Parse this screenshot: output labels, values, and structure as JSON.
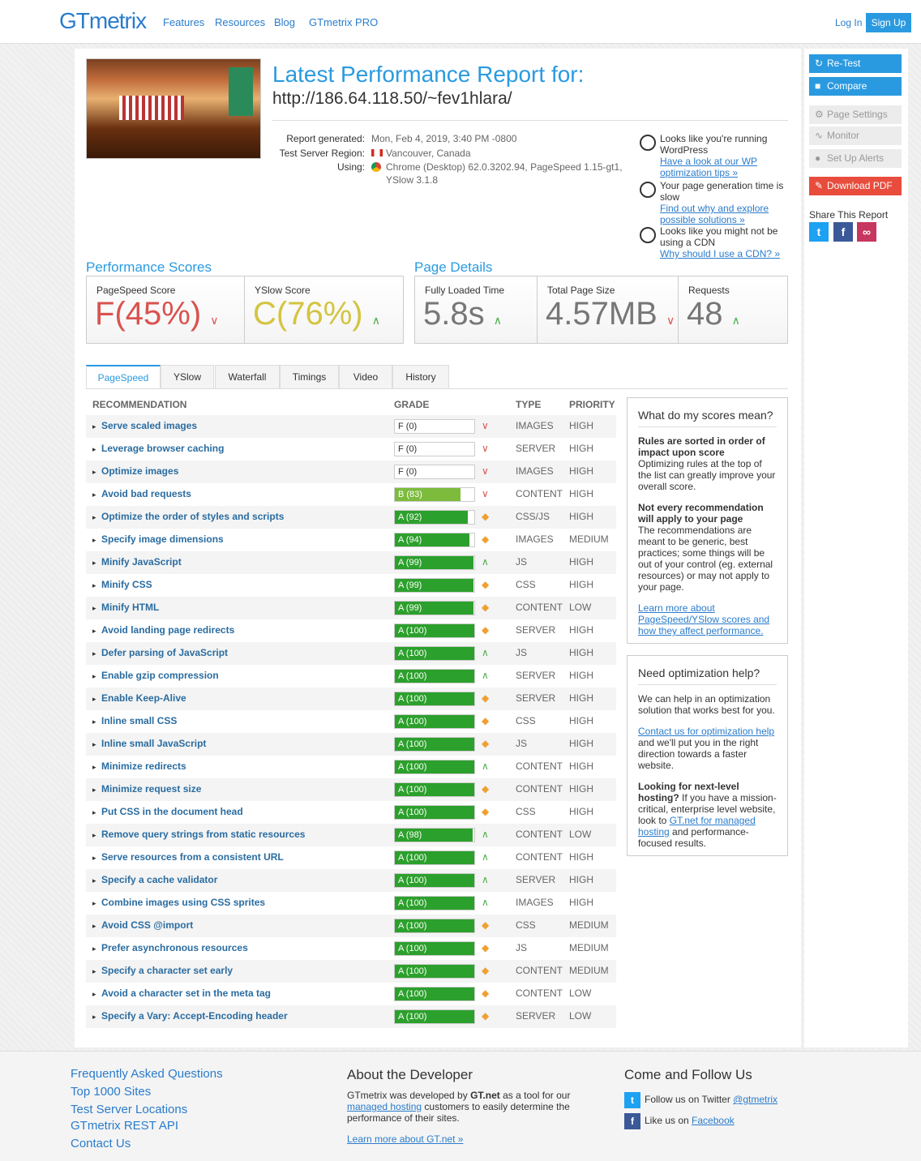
{
  "header": {
    "logo": "GTmetrix",
    "nav": [
      "Features",
      "Resources",
      "Blog",
      "GTmetrix PRO"
    ],
    "login": "Log In",
    "signup": "Sign Up"
  },
  "report": {
    "title": "Latest Performance Report for:",
    "url": "http://186.64.118.50/~fev1hlara/",
    "generated_label": "Report generated:",
    "generated_value": "Mon, Feb 4, 2019, 3:40 PM -0800",
    "region_label": "Test Server Region:",
    "region_value": "Vancouver, Canada",
    "using_label": "Using:",
    "using_value_1": "Chrome (Desktop) 62.0.3202.94, PageSpeed 1.15-gt1,",
    "using_value_2": "YSlow 3.1.8"
  },
  "tips": [
    {
      "text": "Looks like you're running WordPress",
      "link": "Have a look at our WP optimization tips »"
    },
    {
      "text": "Your page generation time is slow",
      "link": "Find out why and explore possible solutions »"
    },
    {
      "text": "Looks like you might not be using a CDN",
      "link": "Why should I use a CDN? »"
    }
  ],
  "scores": {
    "heading": "Performance Scores",
    "pagespeed_label": "PageSpeed Score",
    "pagespeed_grade": "F",
    "pagespeed_pct": "(45%)",
    "yslow_label": "YSlow Score",
    "yslow_grade": "C",
    "yslow_pct": "(76%)"
  },
  "details": {
    "heading": "Page Details",
    "loaded_label": "Fully Loaded Time",
    "loaded_value": "5.8s",
    "size_label": "Total Page Size",
    "size_value": "4.57MB",
    "requests_label": "Requests",
    "requests_value": "48"
  },
  "tabs": [
    "PageSpeed",
    "YSlow",
    "Waterfall",
    "Timings",
    "Video",
    "History"
  ],
  "table_headers": {
    "recommendation": "RECOMMENDATION",
    "grade": "GRADE",
    "type": "TYPE",
    "priority": "PRIORITY"
  },
  "rows": [
    {
      "name": "Serve scaled images",
      "grade": "F (0)",
      "score": 0,
      "trend": "down",
      "type": "IMAGES",
      "priority": "HIGH"
    },
    {
      "name": "Leverage browser caching",
      "grade": "F (0)",
      "score": 0,
      "trend": "down",
      "type": "SERVER",
      "priority": "HIGH"
    },
    {
      "name": "Optimize images",
      "grade": "F (0)",
      "score": 0,
      "trend": "down",
      "type": "IMAGES",
      "priority": "HIGH"
    },
    {
      "name": "Avoid bad requests",
      "grade": "B (83)",
      "score": 83,
      "trend": "down",
      "type": "CONTENT",
      "priority": "HIGH"
    },
    {
      "name": "Optimize the order of styles and scripts",
      "grade": "A (92)",
      "score": 92,
      "trend": "same",
      "type": "CSS/JS",
      "priority": "HIGH"
    },
    {
      "name": "Specify image dimensions",
      "grade": "A (94)",
      "score": 94,
      "trend": "same",
      "type": "IMAGES",
      "priority": "MEDIUM"
    },
    {
      "name": "Minify JavaScript",
      "grade": "A (99)",
      "score": 99,
      "trend": "up",
      "type": "JS",
      "priority": "HIGH"
    },
    {
      "name": "Minify CSS",
      "grade": "A (99)",
      "score": 99,
      "trend": "same",
      "type": "CSS",
      "priority": "HIGH"
    },
    {
      "name": "Minify HTML",
      "grade": "A (99)",
      "score": 99,
      "trend": "same",
      "type": "CONTENT",
      "priority": "LOW"
    },
    {
      "name": "Avoid landing page redirects",
      "grade": "A (100)",
      "score": 100,
      "trend": "same",
      "type": "SERVER",
      "priority": "HIGH"
    },
    {
      "name": "Defer parsing of JavaScript",
      "grade": "A (100)",
      "score": 100,
      "trend": "up",
      "type": "JS",
      "priority": "HIGH"
    },
    {
      "name": "Enable gzip compression",
      "grade": "A (100)",
      "score": 100,
      "trend": "up",
      "type": "SERVER",
      "priority": "HIGH"
    },
    {
      "name": "Enable Keep-Alive",
      "grade": "A (100)",
      "score": 100,
      "trend": "same",
      "type": "SERVER",
      "priority": "HIGH"
    },
    {
      "name": "Inline small CSS",
      "grade": "A (100)",
      "score": 100,
      "trend": "same",
      "type": "CSS",
      "priority": "HIGH"
    },
    {
      "name": "Inline small JavaScript",
      "grade": "A (100)",
      "score": 100,
      "trend": "same",
      "type": "JS",
      "priority": "HIGH"
    },
    {
      "name": "Minimize redirects",
      "grade": "A (100)",
      "score": 100,
      "trend": "up",
      "type": "CONTENT",
      "priority": "HIGH"
    },
    {
      "name": "Minimize request size",
      "grade": "A (100)",
      "score": 100,
      "trend": "same",
      "type": "CONTENT",
      "priority": "HIGH"
    },
    {
      "name": "Put CSS in the document head",
      "grade": "A (100)",
      "score": 100,
      "trend": "same",
      "type": "CSS",
      "priority": "HIGH"
    },
    {
      "name": "Remove query strings from static resources",
      "grade": "A (98)",
      "score": 98,
      "trend": "up",
      "type": "CONTENT",
      "priority": "LOW"
    },
    {
      "name": "Serve resources from a consistent URL",
      "grade": "A (100)",
      "score": 100,
      "trend": "up",
      "type": "CONTENT",
      "priority": "HIGH"
    },
    {
      "name": "Specify a cache validator",
      "grade": "A (100)",
      "score": 100,
      "trend": "up",
      "type": "SERVER",
      "priority": "HIGH"
    },
    {
      "name": "Combine images using CSS sprites",
      "grade": "A (100)",
      "score": 100,
      "trend": "up",
      "type": "IMAGES",
      "priority": "HIGH"
    },
    {
      "name": "Avoid CSS @import",
      "grade": "A (100)",
      "score": 100,
      "trend": "same",
      "type": "CSS",
      "priority": "MEDIUM"
    },
    {
      "name": "Prefer asynchronous resources",
      "grade": "A (100)",
      "score": 100,
      "trend": "same",
      "type": "JS",
      "priority": "MEDIUM"
    },
    {
      "name": "Specify a character set early",
      "grade": "A (100)",
      "score": 100,
      "trend": "same",
      "type": "CONTENT",
      "priority": "MEDIUM"
    },
    {
      "name": "Avoid a character set in the meta tag",
      "grade": "A (100)",
      "score": 100,
      "trend": "same",
      "type": "CONTENT",
      "priority": "LOW"
    },
    {
      "name": "Specify a Vary: Accept-Encoding header",
      "grade": "A (100)",
      "score": 100,
      "trend": "same",
      "type": "SERVER",
      "priority": "LOW"
    }
  ],
  "scores_box": {
    "title": "What do my scores mean?",
    "p1_bold": "Rules are sorted in order of impact upon score",
    "p1_text": "Optimizing rules at the top of the list can greatly improve your overall score.",
    "p2_bold": "Not every recommendation will apply to your page",
    "p2_text": "The recommendations are meant to be generic, best practices; some things will be out of your control (eg. external resources) or may not apply to your page.",
    "link": "Learn more about PageSpeed/YSlow scores and how they affect performance."
  },
  "help_box": {
    "title": "Need optimization help?",
    "p1": "We can help in an optimization solution that works best for you.",
    "link1": "Contact us for optimization help",
    "p2": "and we'll put you in the right direction towards a faster website.",
    "p3_bold": "Looking for next-level hosting?",
    "p3_text": "If you have a mission-critical, enterprise level website, look to",
    "link2": "GT.net for managed hosting",
    "p3_end": "and performance-focused results."
  },
  "actions": {
    "retest": "Re-Test",
    "compare": "Compare",
    "page_settings": "Page Settings",
    "monitor": "Monitor",
    "alerts": "Set Up Alerts",
    "pdf": "Download PDF",
    "share": "Share This Report"
  },
  "footer": {
    "links": [
      "Frequently Asked Questions",
      "Top 1000 Sites",
      "Test Server Locations",
      "GTmetrix REST API",
      "Contact Us"
    ],
    "about_title": "About the Developer",
    "about_1": "GTmetrix was developed by",
    "about_gt": "GT.net",
    "about_2": "as a tool for our",
    "about_link": "managed hosting",
    "about_3": "customers to easily determine the performance of their sites.",
    "about_more": "Learn more about GT.net »",
    "follow_title": "Come and Follow Us",
    "twitter_text": "Follow us on Twitter",
    "twitter_handle": "@gtmetrix",
    "facebook_text": "Like us on",
    "facebook_link": "Facebook"
  },
  "colors": {
    "accent": "#2a9ae0",
    "grade_a": "#2ca02c",
    "grade_b": "#7cbb3c",
    "grade_f": "#d9534f",
    "grade_c": "#d4c441"
  }
}
